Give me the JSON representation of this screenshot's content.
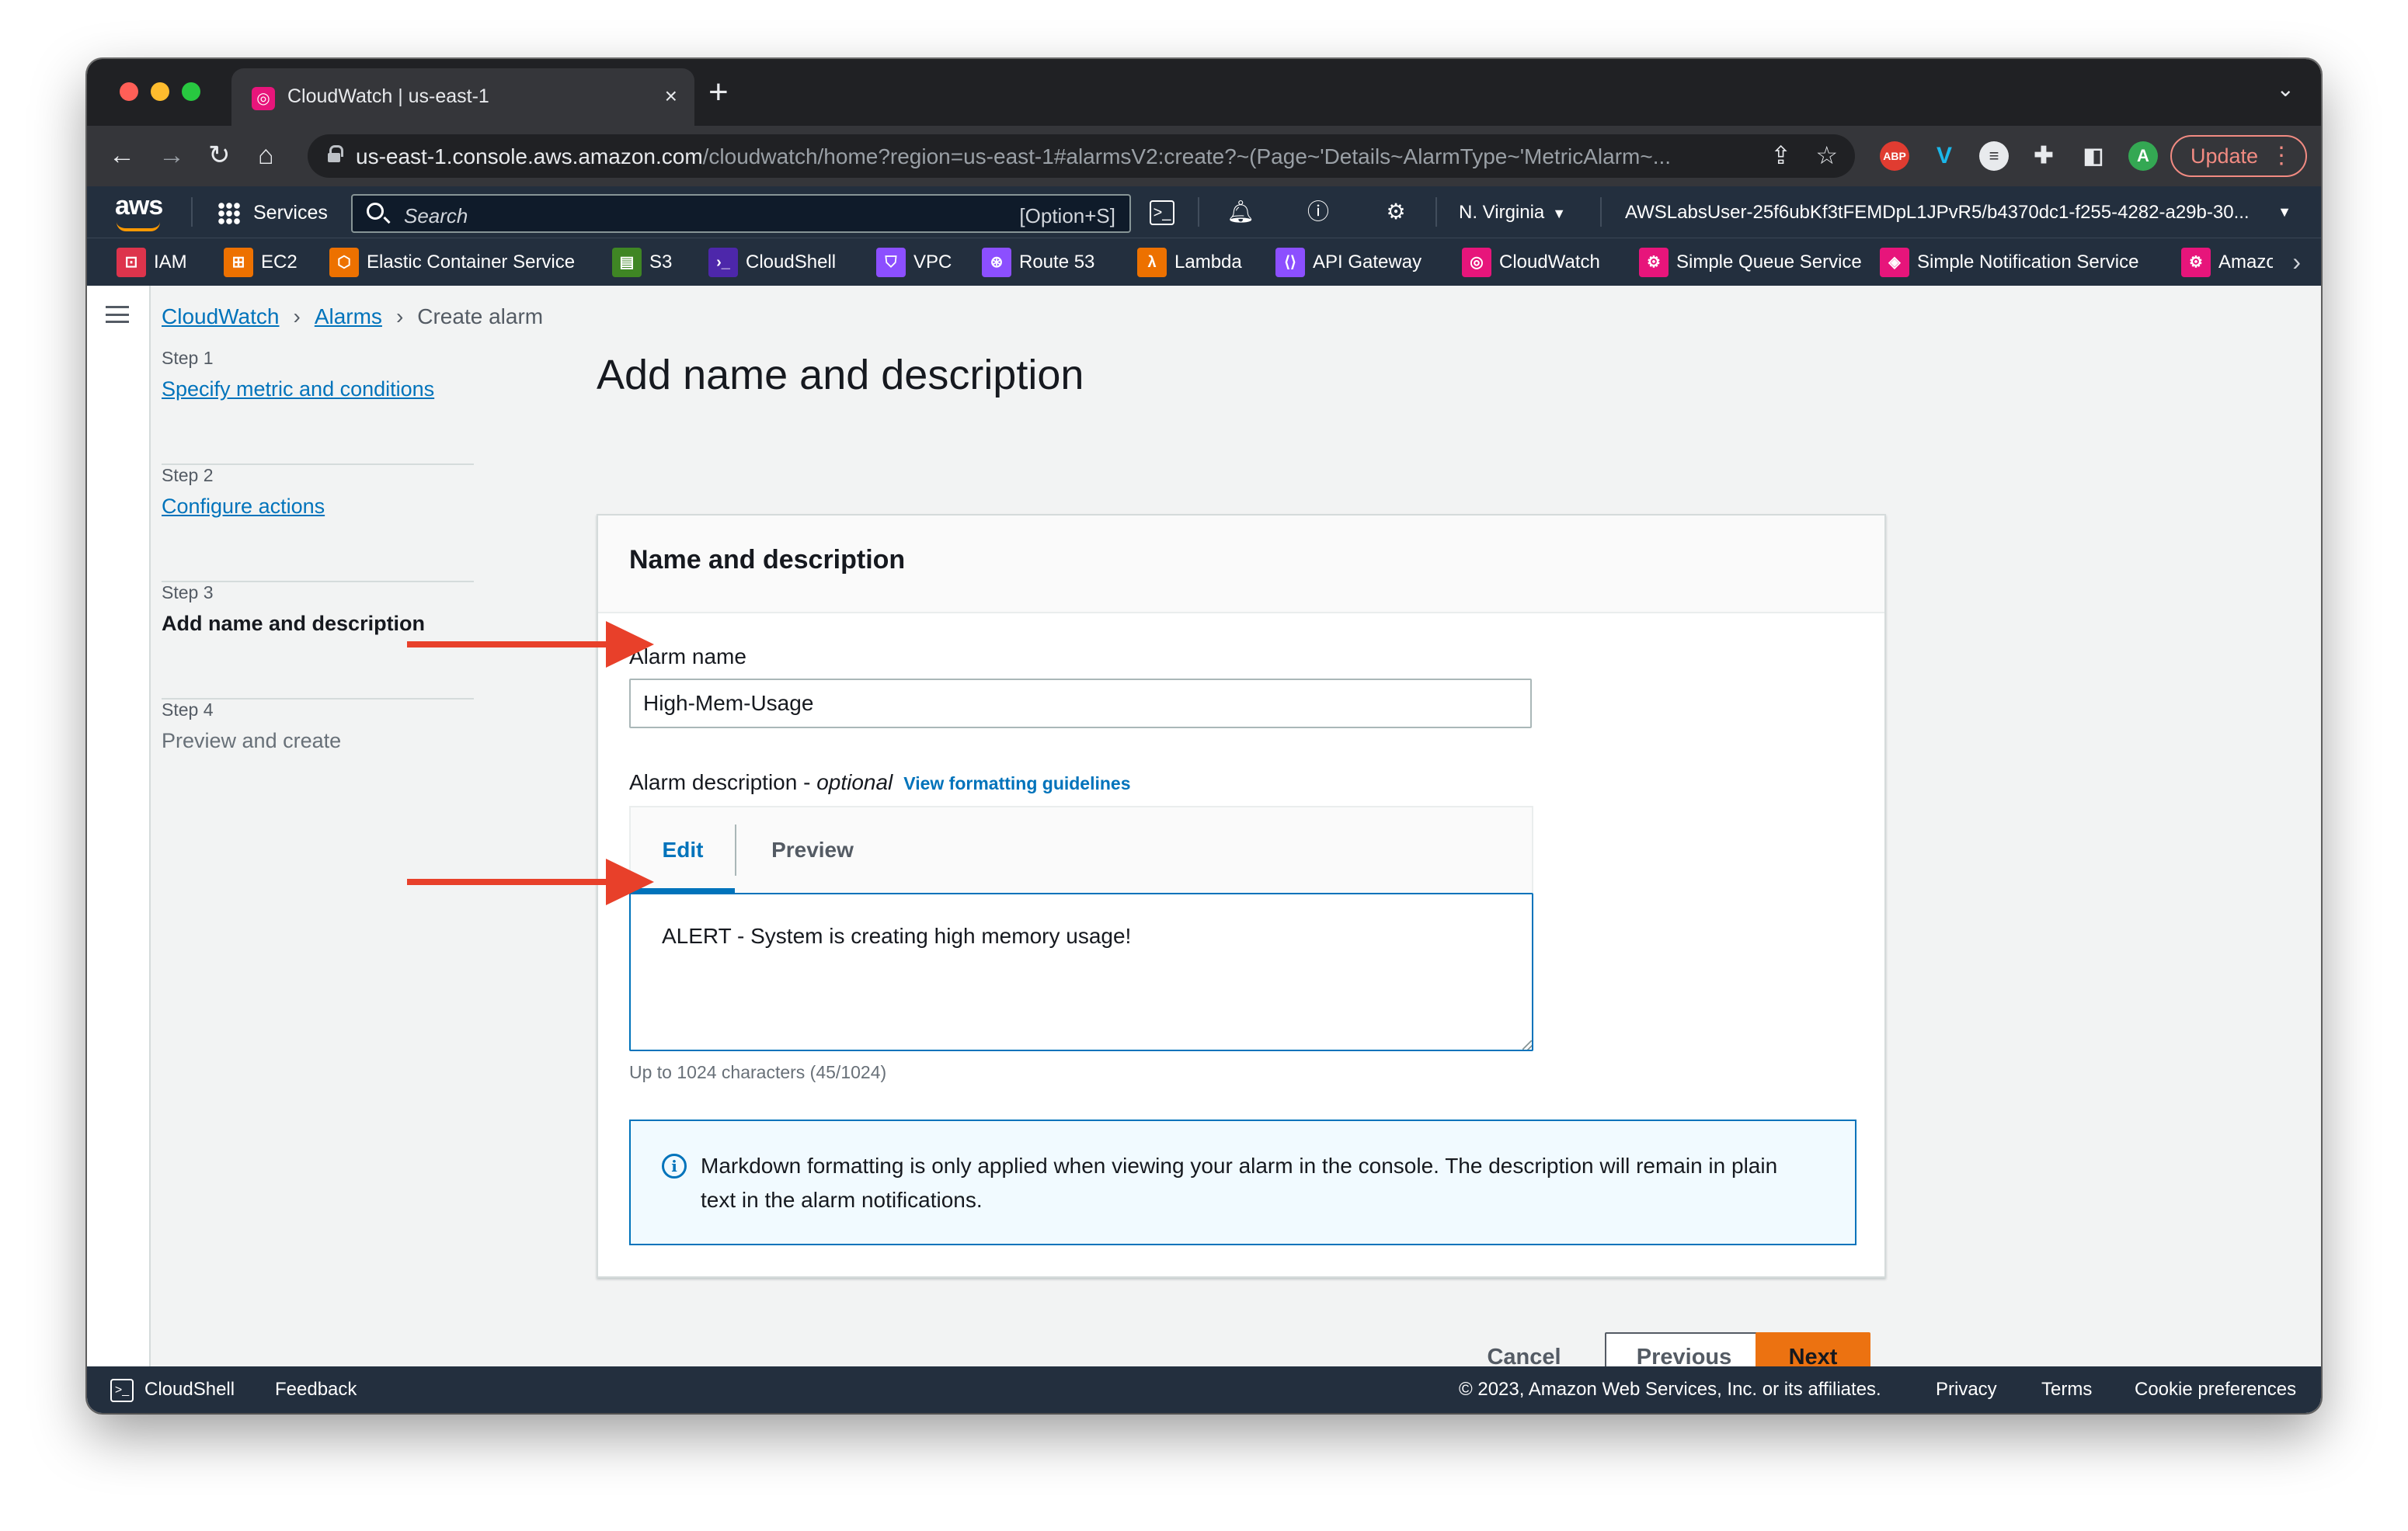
{
  "browser": {
    "tab_title": "CloudWatch | us-east-1",
    "tab_close": "×",
    "new_tab": "+",
    "url_host": "us-east-1.console.aws.amazon.com",
    "url_path": "/cloudwatch/home?region=us-east-1#alarmsV2:create?~(Page~'Details~AlarmType~'MetricAlarm~...",
    "update_label": "Update",
    "extensions": [
      "ABP",
      "V",
      "A"
    ]
  },
  "aws_nav": {
    "logo": "aws",
    "services_label": "Services",
    "search_placeholder": "Search",
    "search_shortcut": "[Option+S]",
    "region": "N. Virginia",
    "account": "AWSLabsUser-25f6ubKf3tFEMDpL1JPvR5/b4370dc1-f255-4282-a29b-30..."
  },
  "favorites": [
    {
      "label": "IAM",
      "color": "#dd344c"
    },
    {
      "label": "EC2",
      "color": "#ed7100"
    },
    {
      "label": "Elastic Container Service",
      "color": "#ed7100"
    },
    {
      "label": "S3",
      "color": "#3f8624"
    },
    {
      "label": "CloudShell",
      "color": "#4d27aa"
    },
    {
      "label": "VPC",
      "color": "#8c4fff"
    },
    {
      "label": "Route 53",
      "color": "#8c4fff"
    },
    {
      "label": "Lambda",
      "color": "#ed7100"
    },
    {
      "label": "API Gateway",
      "color": "#8c4fff"
    },
    {
      "label": "CloudWatch",
      "color": "#e7157b"
    },
    {
      "label": "Simple Queue Service",
      "color": "#e7157b"
    },
    {
      "label": "Simple Notification Service",
      "color": "#e7157b"
    },
    {
      "label": "Amazo",
      "color": "#e7157b"
    }
  ],
  "breadcrumb": {
    "items": [
      "CloudWatch",
      "Alarms"
    ],
    "current": "Create alarm"
  },
  "steps": [
    {
      "num": "Step 1",
      "title": "Specify metric and conditions"
    },
    {
      "num": "Step 2",
      "title": "Configure actions"
    },
    {
      "num": "Step 3",
      "title": "Add name and description"
    },
    {
      "num": "Step 4",
      "title": "Preview and create"
    }
  ],
  "main": {
    "page_title": "Add name and description",
    "panel_title": "Name and description",
    "alarm_name_label": "Alarm name",
    "alarm_name_value": "High-Mem-Usage",
    "alarm_desc_label": "Alarm description - ",
    "alarm_desc_optional": "optional",
    "view_guidelines": "View formatting guidelines",
    "tab_edit": "Edit",
    "tab_preview": "Preview",
    "description_value": "ALERT - System is creating high memory usage!",
    "char_count": "Up to 1024 characters (45/1024)",
    "info_text": "Markdown formatting is only applied when viewing your alarm in the console. The description will remain in plain text in the alarm notifications.",
    "info_icon": "i"
  },
  "actions": {
    "cancel": "Cancel",
    "previous": "Previous",
    "next": "Next"
  },
  "footer": {
    "cloudshell": "CloudShell",
    "feedback": "Feedback",
    "copyright": "© 2023, Amazon Web Services, Inc. or its affiliates.",
    "privacy": "Privacy",
    "terms": "Terms",
    "cookies": "Cookie preferences"
  },
  "colors": {
    "accent_link": "#0073bb",
    "primary_button": "#ec7211",
    "annotation_arrow": "#e8402a",
    "aws_nav_bg": "#232f3e"
  }
}
